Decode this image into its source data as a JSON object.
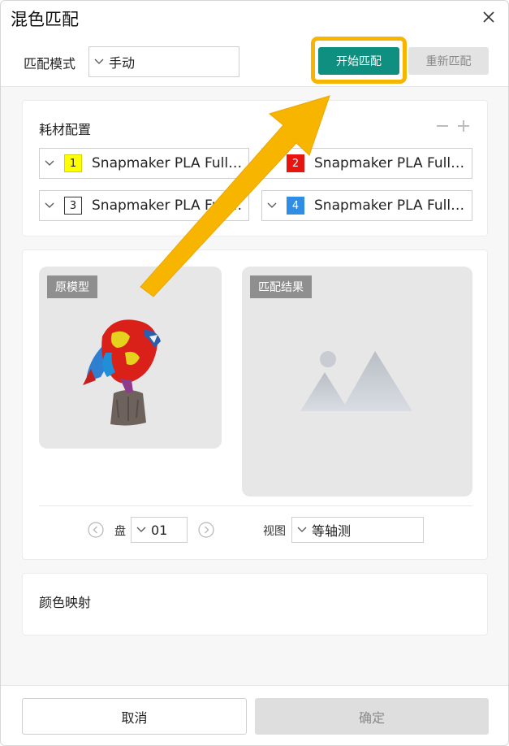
{
  "dialog": {
    "title": "混色匹配",
    "close_icon": "close-icon"
  },
  "mode": {
    "label": "匹配模式",
    "value": "手动",
    "start_button": "开始匹配",
    "rematch_button": "重新匹配"
  },
  "materials": {
    "title": "耗材配置",
    "items": [
      {
        "number": "1",
        "name": "Snapmaker PLA Full ...",
        "color": "#ffff00",
        "num_color": "#222222"
      },
      {
        "number": "2",
        "name": "Snapmaker PLA Full S...",
        "color": "#e8140f",
        "num_color": "#ffffff"
      },
      {
        "number": "3",
        "name": "Snapmaker PLA Full S...",
        "color": "#ffffff",
        "num_color": "#222222"
      },
      {
        "number": "4",
        "name": "Snapmaker PLA Full S...",
        "color": "#2f8de4",
        "num_color": "#ffffff"
      }
    ]
  },
  "preview": {
    "original_label": "原模型",
    "result_label": "匹配结果",
    "plate_label": "盘",
    "plate_value": "01",
    "view_label": "视图",
    "view_value": "等轴测"
  },
  "color_mapping": {
    "title": "颜色映射"
  },
  "footer": {
    "cancel": "取消",
    "confirm": "确定"
  },
  "colors": {
    "accent": "#0e8f80",
    "highlight": "#f7b500"
  }
}
